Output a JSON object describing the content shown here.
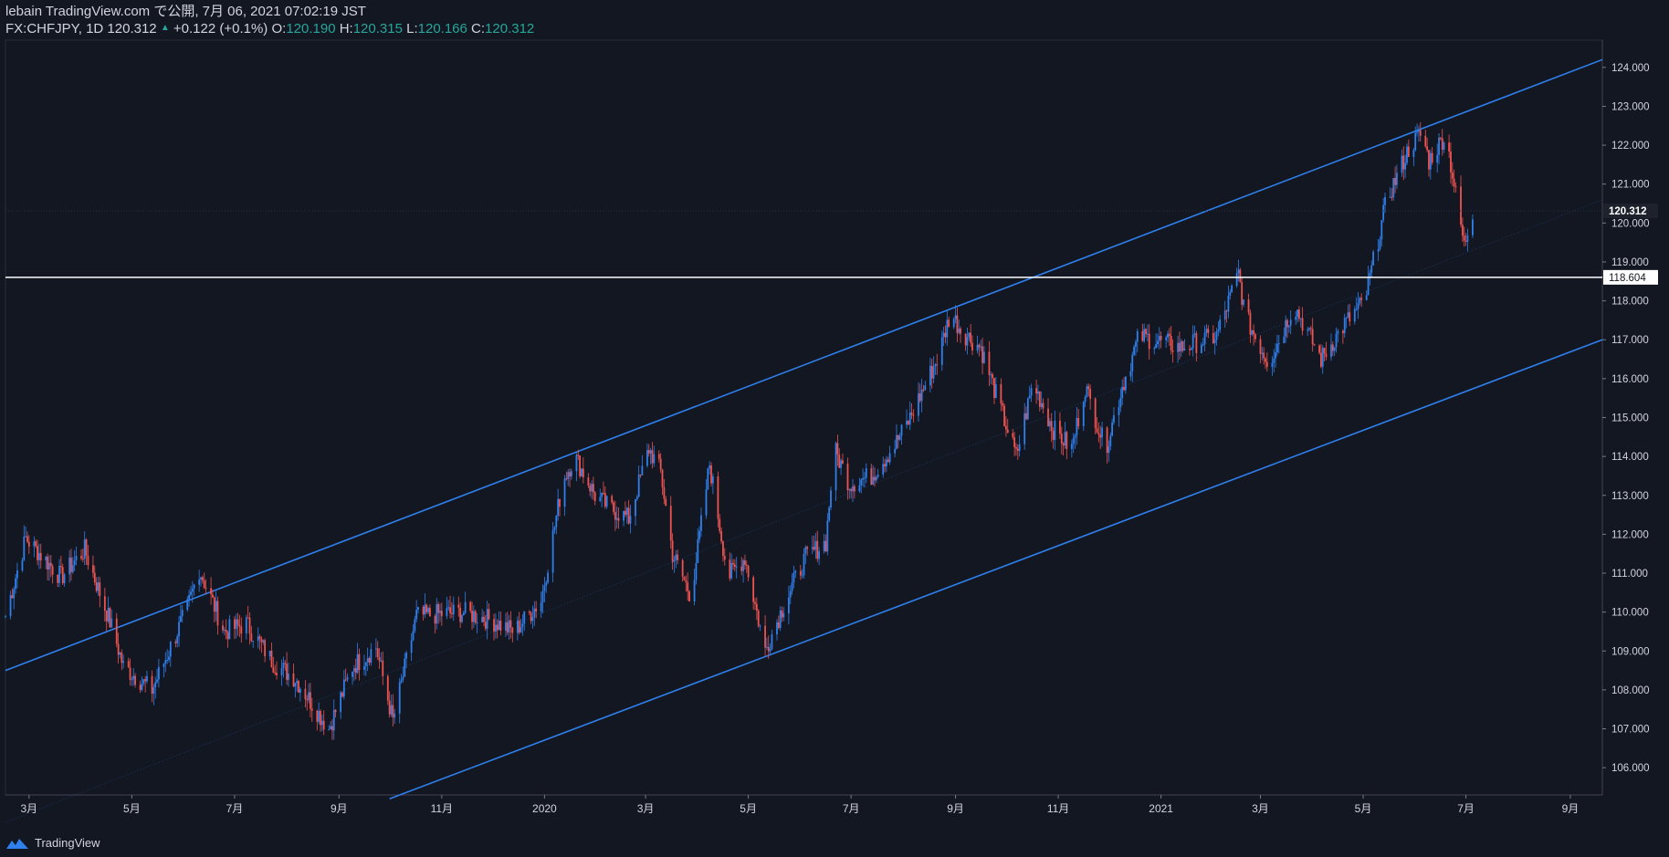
{
  "header": {
    "line1": "lebain TradingView.com で公開, 7月 06, 2021 07:02:19 JST",
    "symbol": "FX:CHFJPY, 1D 120.312",
    "arrow": "▲",
    "change": "+0.122 (+0.1%)",
    "o_label": "O:",
    "o_value": "120.190",
    "h_label": "H:",
    "h_value": "120.315",
    "l_label": "L:",
    "l_value": "120.166",
    "c_label": "C:",
    "c_value": "120.312"
  },
  "footer": {
    "brand": "TradingView",
    "logo_icon": "tradingview-logo-icon"
  },
  "colors": {
    "background": "#131722",
    "up_candle": "#2f80ed",
    "down_candle": "#ef5350",
    "channel_line": "#2f80ed",
    "support_line": "#ffffff",
    "text": "#d1d4dc",
    "value_green": "#26a69a"
  },
  "chart_data": {
    "type": "line",
    "instrument": "FX:CHFJPY",
    "interval": "1D",
    "ylim": [
      105.3,
      124.7
    ],
    "y_ticks": [
      "124.000",
      "123.000",
      "122.000",
      "121.000",
      "120.000",
      "119.000",
      "118.000",
      "117.000",
      "116.000",
      "115.000",
      "114.000",
      "113.000",
      "112.000",
      "111.000",
      "110.000",
      "109.000",
      "108.000",
      "107.000",
      "106.000"
    ],
    "x_ticks": [
      "3月",
      "5月",
      "7月",
      "9月",
      "11月",
      "2020",
      "3月",
      "5月",
      "7月",
      "9月",
      "11月",
      "2021",
      "3月",
      "5月",
      "7月",
      "9月"
    ],
    "price_labels": [
      "120.312",
      "118.604"
    ],
    "horizontal_line": {
      "value": 118.604,
      "label": "118.604"
    },
    "last_price": {
      "value": 120.312,
      "label": "120.312"
    },
    "channel": {
      "upper": [
        {
          "date": "2019-02-15",
          "value": 108.5
        },
        {
          "date": "2021-09-20",
          "value": 124.2
        }
      ],
      "lower": [
        {
          "date": "2019-10-01",
          "value": 105.2
        },
        {
          "date": "2021-09-20",
          "value": 117.0
        }
      ],
      "mid": [
        {
          "date": "2019-02-15",
          "value": 104.6
        },
        {
          "date": "2021-09-20",
          "value": 120.6
        }
      ]
    },
    "series": [
      {
        "x": [
          "2019-02-15",
          "2019-02-27",
          "2019-03-20",
          "2019-04-03",
          "2019-04-20",
          "2019-04-26",
          "2019-05-13",
          "2019-06-03",
          "2019-06-10",
          "2019-06-25",
          "2019-07-08",
          "2019-07-24",
          "2019-08-06",
          "2019-08-26",
          "2019-09-09",
          "2019-09-23",
          "2019-10-03",
          "2019-10-17",
          "2019-11-14",
          "2019-11-30",
          "2019-12-14",
          "2019-12-30",
          "2020-01-12",
          "2020-01-19",
          "2020-01-31",
          "2020-02-08",
          "2020-02-20",
          "2020-03-03",
          "2020-03-10",
          "2020-03-17",
          "2020-03-28",
          "2020-04-08",
          "2020-04-19",
          "2020-04-29",
          "2020-05-11",
          "2020-05-23",
          "2020-06-04",
          "2020-06-16",
          "2020-06-21",
          "2020-06-30",
          "2020-07-13",
          "2020-07-27",
          "2020-08-04",
          "2020-08-22",
          "2020-08-29",
          "2020-09-05",
          "2020-09-16",
          "2020-09-28",
          "2020-10-07",
          "2020-10-17",
          "2020-10-29",
          "2020-11-09",
          "2020-11-17",
          "2020-11-29",
          "2020-12-09",
          "2020-12-19",
          "2021-01-13",
          "2021-02-03",
          "2021-02-16",
          "2021-02-20",
          "2021-03-06",
          "2021-03-21",
          "2021-04-06",
          "2021-04-20",
          "2021-05-02",
          "2021-05-15",
          "2021-05-29",
          "2021-06-05",
          "2021-06-09",
          "2021-06-19",
          "2021-06-30",
          "2021-07-03",
          "2021-07-05"
        ],
        "values": [
          109.9,
          111.9,
          110.9,
          111.6,
          109.5,
          108.6,
          108.0,
          110.1,
          111.1,
          109.5,
          109.7,
          108.7,
          108.3,
          107.0,
          108.6,
          109.1,
          107.2,
          109.9,
          110.0,
          109.8,
          109.5,
          110.3,
          113.4,
          114.0,
          113.0,
          112.7,
          112.4,
          114.2,
          113.6,
          111.5,
          110.4,
          113.8,
          110.9,
          111.4,
          109.0,
          110.3,
          111.4,
          111.8,
          114.2,
          113.3,
          113.5,
          114.3,
          114.9,
          116.6,
          117.7,
          117.2,
          116.8,
          115.2,
          114.0,
          115.9,
          114.7,
          114.2,
          115.8,
          114.2,
          115.8,
          117.1,
          116.8,
          117.1,
          118.7,
          117.6,
          116.4,
          117.9,
          116.5,
          117.4,
          118.0,
          120.6,
          122.0,
          122.3,
          121.6,
          122.3,
          119.4,
          120.0,
          120.3
        ]
      }
    ]
  }
}
